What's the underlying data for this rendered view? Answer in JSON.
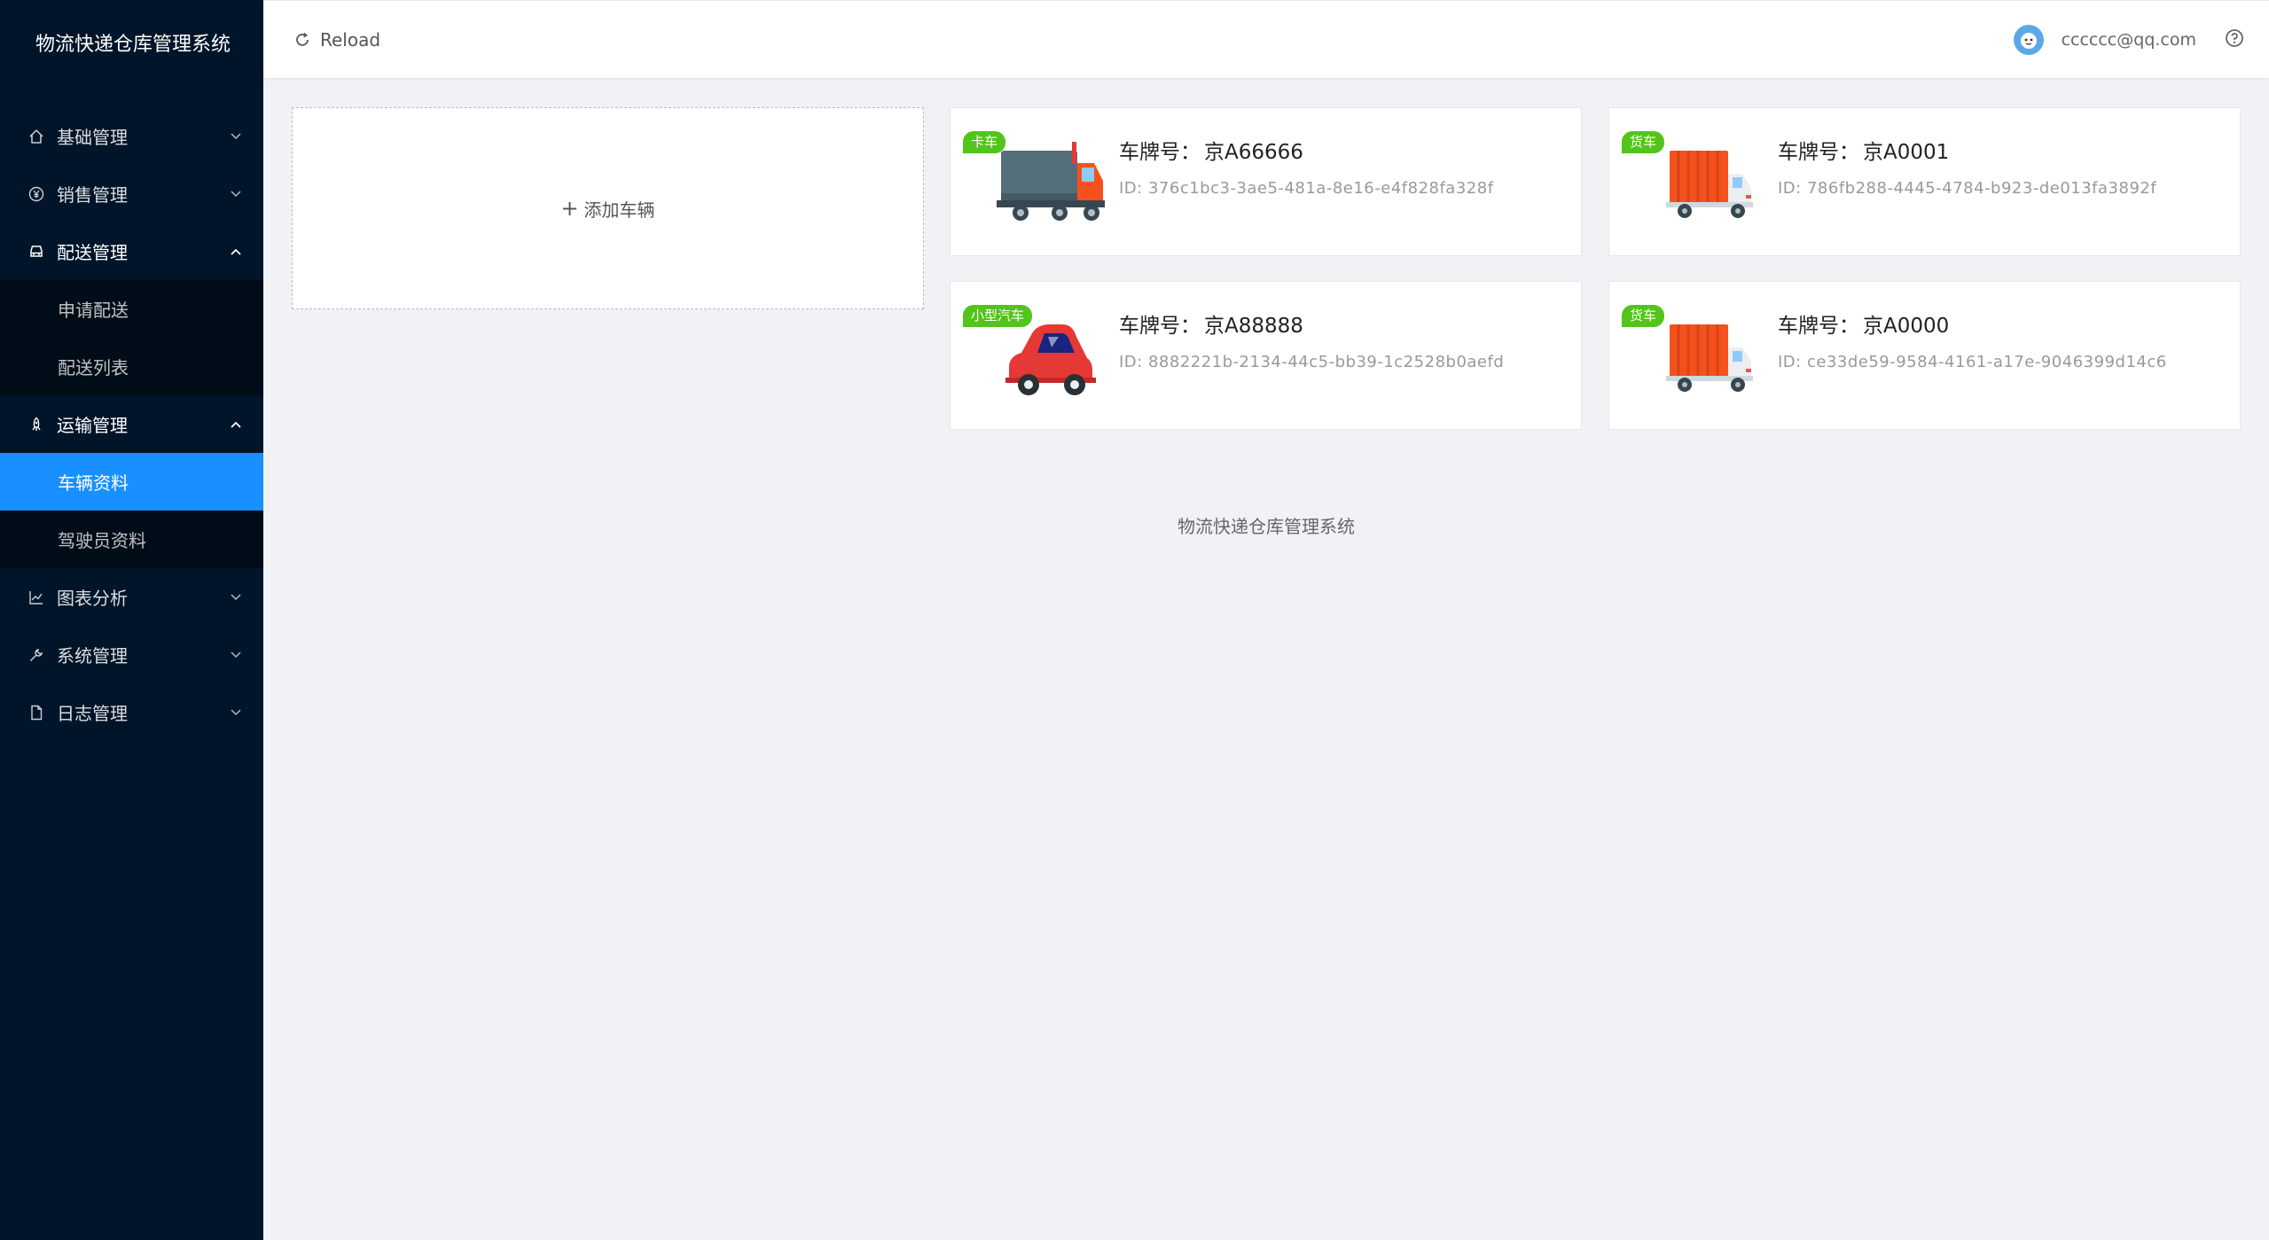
{
  "app": {
    "title": "物流快递仓库管理系统"
  },
  "sidebar": {
    "items": [
      {
        "label": "基础管理",
        "icon": "home-icon",
        "open": false
      },
      {
        "label": "销售管理",
        "icon": "yen-icon",
        "open": false
      },
      {
        "label": "配送管理",
        "icon": "car-icon",
        "open": true,
        "children": [
          {
            "label": "申请配送"
          },
          {
            "label": "配送列表"
          }
        ]
      },
      {
        "label": "运输管理",
        "icon": "rocket-icon",
        "open": true,
        "children": [
          {
            "label": "车辆资料",
            "active": true
          },
          {
            "label": "驾驶员资料"
          }
        ]
      },
      {
        "label": "图表分析",
        "icon": "line-chart-icon",
        "open": false
      },
      {
        "label": "系统管理",
        "icon": "tool-icon",
        "open": false
      },
      {
        "label": "日志管理",
        "icon": "file-icon",
        "open": false
      }
    ]
  },
  "header": {
    "reload_label": "Reload",
    "user_email": "cccccc@qq.com"
  },
  "main": {
    "add_vehicle_label": "添加车辆",
    "plate_prefix": "车牌号：",
    "id_prefix": "ID: ",
    "vehicles": [
      {
        "tag": "卡车",
        "plate": "京A66666",
        "id": "376c1bc3-3ae5-481a-8e16-e4f828fa328f",
        "image": "truck"
      },
      {
        "tag": "货车",
        "plate": "京A0001",
        "id": "786fb288-4445-4784-b923-de013fa3892f",
        "image": "van"
      },
      {
        "tag": "小型汽车",
        "plate": "京A88888",
        "id": "8882221b-2134-44c5-bb39-1c2528b0aefd",
        "image": "car"
      },
      {
        "tag": "货车",
        "plate": "京A0000",
        "id": "ce33de59-9584-4161-a17e-9046399d14c6",
        "image": "van"
      }
    ],
    "footer": "物流快递仓库管理系统"
  },
  "colors": {
    "sidebar_bg": "#001529",
    "active": "#1890ff",
    "tag": "#52c41a"
  }
}
